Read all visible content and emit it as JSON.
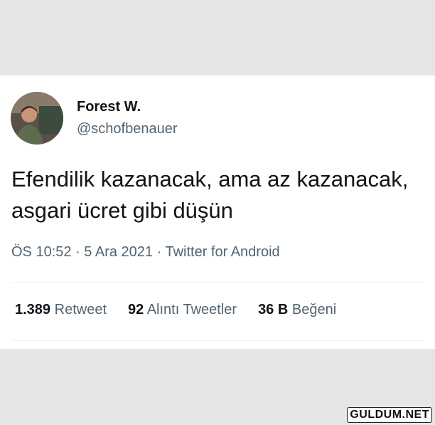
{
  "tweet": {
    "author_name": "Forest W.",
    "author_handle": "@schofbenauer",
    "avatar_icon": "user-avatar-photo",
    "text": "Efendilik kazanacak, ama az kazanacak, asgari ücret gibi düşün",
    "time": "ÖS 10:52",
    "separator": " · ",
    "date": "5 Ara 2021",
    "source": "Twitter for Android",
    "stats": [
      {
        "count": "1.389",
        "label": "Retweet"
      },
      {
        "count": "92",
        "label": "Alıntı Tweetler"
      },
      {
        "count": "36 B",
        "label": "Beğeni"
      }
    ]
  },
  "watermark": "GULDUM.NET",
  "colors": {
    "background": "#e6e6e6",
    "card": "#ffffff",
    "primary_text": "#0f1419",
    "secondary_text": "#536471"
  }
}
